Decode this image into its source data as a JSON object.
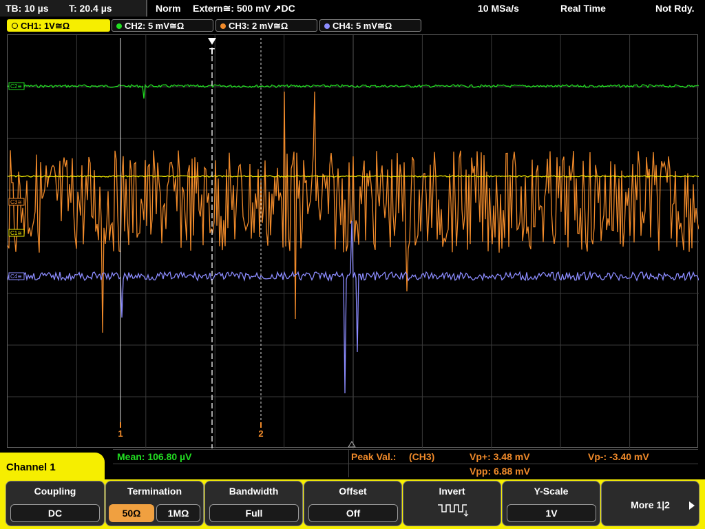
{
  "topbar": {
    "timebase": "TB: 10 µs",
    "trigger_time": "T: 20.4 µs",
    "mode": "Norm",
    "trigger_source": "Extern≅: 500 mV ↗DC",
    "sample_rate": "10 MSa/s",
    "acq_mode": "Real Time",
    "status": "Not Rdy."
  },
  "channels": [
    {
      "label": "CH1: 1V≅Ω",
      "color": "#f6ee00"
    },
    {
      "label": "CH2: 5 mV≅Ω",
      "color": "#22dd22"
    },
    {
      "label": "CH3: 2 mV≅Ω",
      "color": "#f08a2a"
    },
    {
      "label": "CH4: 5 mV≅Ω",
      "color": "#8c8cff"
    }
  ],
  "scope": {
    "trigger_marker": "T",
    "cursor1_label": "1",
    "cursor2_label": "2",
    "ref_markers": [
      "C2≅",
      "C3≅",
      "C1≅",
      "C4≅"
    ]
  },
  "measurements": {
    "mean": "Mean: 106.80 µV",
    "peak_label": "Peak Val.:",
    "peak_source": "(CH3)",
    "vp_plus": "Vp+: 3.48 mV",
    "vp_minus": "Vp-: -3.40 mV",
    "vpp": "Vpp: 6.88 mV"
  },
  "menu_title": "Channel 1",
  "softkeys": {
    "coupling": {
      "title": "Coupling",
      "value": "DC"
    },
    "termination": {
      "title": "Termination",
      "opt1": "50Ω",
      "opt2": "1MΩ"
    },
    "bandwidth": {
      "title": "Bandwidth",
      "value": "Full"
    },
    "offset": {
      "title": "Offset",
      "value": "Off"
    },
    "invert": {
      "title": "Invert"
    },
    "yscale": {
      "title": "Y-Scale",
      "value": "1V"
    },
    "more": {
      "label": "More 1|2"
    }
  },
  "colors": {
    "accent": "#f6ee00",
    "ch2": "#22dd22",
    "ch3": "#f08a2a",
    "ch4": "#8c8cff",
    "grid": "#3a3a3a"
  }
}
